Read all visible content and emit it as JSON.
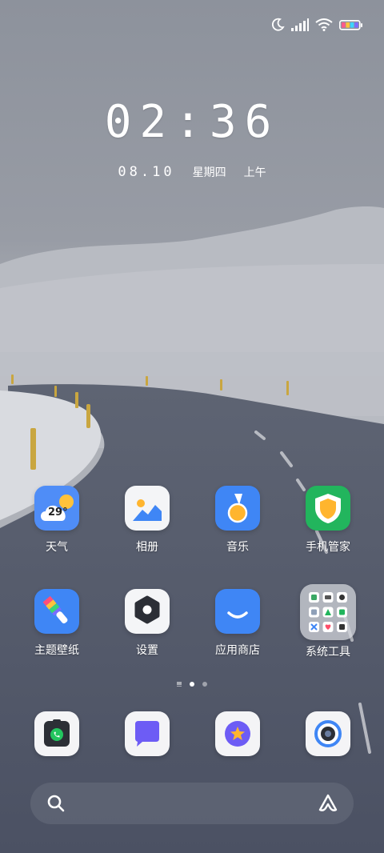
{
  "status_bar": {
    "icons": [
      "moon-icon",
      "signal-icon",
      "wifi-icon",
      "battery-icon"
    ],
    "battery_colors": [
      "#ff5a8a",
      "#ffc23b",
      "#3bd3ff",
      "#7b6cff"
    ]
  },
  "lock": {
    "time": "02:36",
    "date": "08.10",
    "weekday": "星期四",
    "period": "上午"
  },
  "apps": [
    {
      "id": "weather",
      "label": "天气",
      "icon": "weather-icon",
      "temp": "29°",
      "color": "#4f8df7"
    },
    {
      "id": "gallery",
      "label": "相册",
      "icon": "gallery-icon",
      "color": "#f4f5f7"
    },
    {
      "id": "music",
      "label": "音乐",
      "icon": "music-icon",
      "color": "#3f86f5"
    },
    {
      "id": "security",
      "label": "手机管家",
      "icon": "shield-icon",
      "color": "#22b55d"
    },
    {
      "id": "themes",
      "label": "主题壁纸",
      "icon": "brush-icon",
      "color": "#3f86f5"
    },
    {
      "id": "settings",
      "label": "设置",
      "icon": "gear-icon",
      "color": "#f4f5f7"
    },
    {
      "id": "appstore",
      "label": "应用商店",
      "icon": "store-bag-icon",
      "color": "#3f86f5"
    },
    {
      "id": "system-tools",
      "label": "系统工具",
      "icon": "folder-icon",
      "color": "#b9bcc4"
    }
  ],
  "page_indicator": {
    "pages": 2,
    "current": 1
  },
  "dock": [
    {
      "id": "phone",
      "icon": "phone-icon"
    },
    {
      "id": "messages",
      "icon": "message-icon"
    },
    {
      "id": "browser",
      "icon": "browser-star-icon"
    },
    {
      "id": "camera",
      "icon": "camera-icon"
    }
  ],
  "search": {
    "icon": "search-icon",
    "assistant_icon": "assistant-icon"
  }
}
